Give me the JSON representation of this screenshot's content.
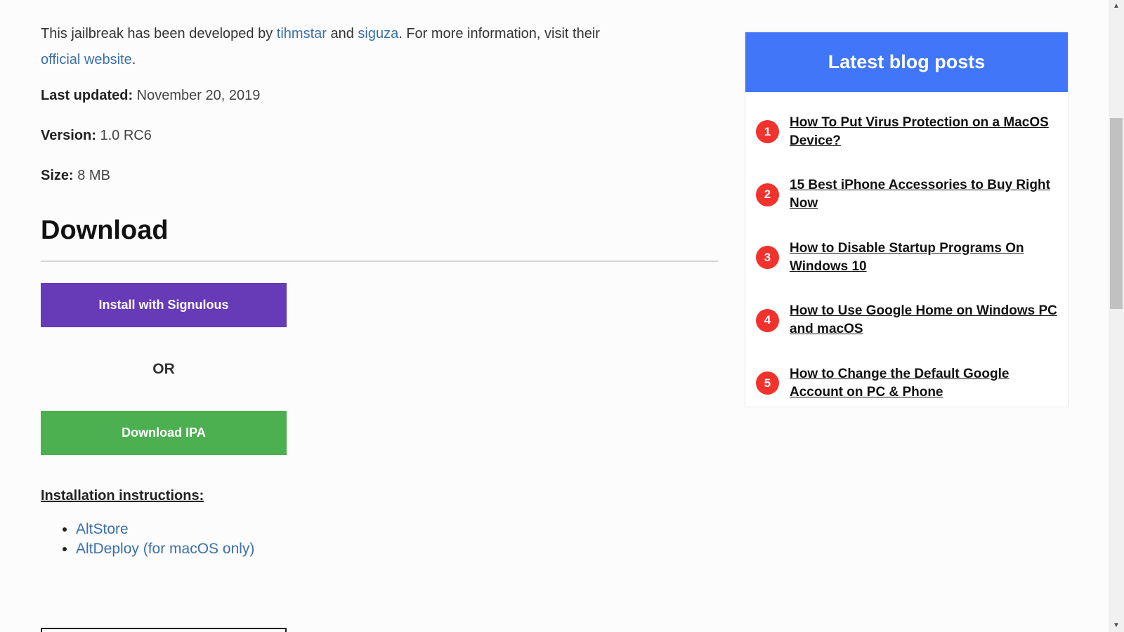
{
  "intro": {
    "text_before": "This jailbreak has been developed by ",
    "author1": "tihmstar",
    "and": " and ",
    "author2": "siguza",
    "text_after": ". For more information, visit their ",
    "website_link": "official website",
    "period": "."
  },
  "meta": {
    "last_updated_label": "Last updated:",
    "last_updated_value": " November 20, 2019",
    "version_label": "Version:",
    "version_value": " 1.0 RC6",
    "size_label": "Size:",
    "size_value": " 8 MB"
  },
  "download": {
    "heading": "Download",
    "signulous_button": "Install with Signulous",
    "or_text": "OR",
    "ipa_button": "Download IPA",
    "instructions_heading": "Installation instructions:",
    "instructions": [
      "AltStore",
      "AltDeploy (for macOS only)"
    ]
  },
  "sidebar": {
    "title": "Latest blog posts",
    "posts": [
      {
        "num": "1",
        "title": "How To Put Virus Protection on a MacOS Device?"
      },
      {
        "num": "2",
        "title": "15 Best iPhone Accessories to Buy Right Now"
      },
      {
        "num": "3",
        "title": "How to Disable Startup Programs On Windows 10"
      },
      {
        "num": "4",
        "title": "How to Use Google Home on Windows PC and macOS"
      },
      {
        "num": "5",
        "title": "How to Change the Default Google Account on PC & Phone"
      }
    ]
  },
  "colors": {
    "link": "#3a6fa8",
    "signulous": "#673ab7",
    "ipa": "#4caf50",
    "sidebar_header": "#4076f7",
    "badge": "#f1322d"
  },
  "icons": {
    "scroll_up": "scroll-up-arrow-icon",
    "scroll_down": "scroll-down-arrow-icon"
  }
}
